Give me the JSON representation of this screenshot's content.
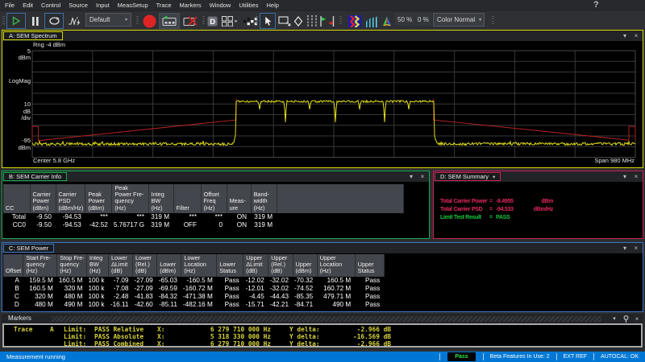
{
  "app": {
    "help_icon": "?"
  },
  "menu": {
    "items": [
      "File",
      "Edit",
      "Control",
      "Source",
      "Input",
      "MeasSetup",
      "Trace",
      "Markers",
      "Window",
      "Utilities",
      "Help"
    ]
  },
  "toolbar": {
    "icons": [
      "play-icon",
      "pause-icon",
      "restart-loop-icon",
      "single-sweep-icon",
      "record-icon",
      "recorder-player-icon",
      "recorder-close-icon",
      "display-d-icon",
      "window-layout-icon",
      "couplings-dots-icon",
      "select-cursor-icon",
      "zoom-box-icon",
      "marker-diamond-icon",
      "band-lines-icon",
      "limit-flags-icon",
      "spectrogram-icon",
      "waterfall-icon",
      "colormap-icon"
    ],
    "preset_combo": "Default",
    "percent_50": "50 %",
    "percent_0": "0 %",
    "color_combo": "Color Normal",
    "combo_caret": "▾"
  },
  "windows": {
    "spectrum": {
      "title": "A: SEM Spectrum",
      "minimize_icon": "▾",
      "close_icon": "×",
      "rng_label": "Rng -4 dBm",
      "y_top": "5",
      "y_top_unit": "dBm",
      "scale_label": "LogMag",
      "per_div_1": "10",
      "per_div_2": "dB",
      "per_div_3": "/div",
      "y_bottom": "-95",
      "y_bottom_unit": "dBm",
      "x_left": "Center 5.8 GHz",
      "x_right": "Span 980 MHz"
    },
    "carrier_info": {
      "title": "B: SEM Carrier Info",
      "headers": [
        "CC",
        "Carrier\nPower\n(dBm)",
        "Carrier\nPSD\n(dBm/Hz)",
        "Peak\nPower\n(dBm)",
        "Peak\nPower Fre-\nquency\n(Hz)",
        "Integ\nBW\n(Hz)",
        "Filter",
        "Offset\nFreq\n(Hz)",
        "Meas-\nure",
        "Band-\nwidth\n(Hz)",
        ""
      ],
      "rows": [
        [
          "Total",
          "-9.50",
          "-94.53",
          "***",
          "***",
          "319 M",
          "***",
          "***",
          "ON",
          "319 M",
          ""
        ],
        [
          "CC0",
          "-9.50",
          "-94.53",
          "-42.52",
          "5.76717 G",
          "319 M",
          "OFF",
          "0",
          "ON",
          "319 M",
          ""
        ]
      ]
    },
    "summary": {
      "title": "D: SEM Summary",
      "dropdown_icon": "▾",
      "lines": [
        {
          "label": "Total Carrier Power",
          "eq": "=",
          "value": "-9.4955",
          "unit": "dBm",
          "color": "red"
        },
        {
          "label": "Total Carrier PSD",
          "eq": "=",
          "value": "-94.533",
          "unit": "dBm/Hz",
          "color": "red"
        },
        {
          "label": "Limit Test Result",
          "eq": "=",
          "value": "PASS",
          "unit": "",
          "color": "green"
        }
      ]
    },
    "power": {
      "title": "C: SEM Power",
      "headers": [
        "Offset",
        "Start Fre-\nquency\n(Hz)",
        "Stop Fre-\nquency\n(Hz)",
        "Integ\nBW\n(Hz)",
        "Lower\nΔLimit\n(dB)",
        "Lower\n(Rel.)\n(dB)",
        "Lower\n(dBm)",
        "Lower\nLocation\n(Hz)",
        "Lower\nStatus",
        "Upper\nΔLimit\n(dB)",
        "Upper\n(Rel.)\n(dB)",
        "Upper\n(dBm)",
        "Upper\nLocation\n(Hz)",
        "Upper\nStatus"
      ],
      "rows": [
        [
          "A",
          "159.5 M",
          "160.5 M",
          "100 k",
          "-7.09",
          "-27.09",
          "-65.03",
          "-160.5 M",
          "Pass",
          "-12.02",
          "-32.02",
          "-70.32",
          "160.5 M",
          "Pass"
        ],
        [
          "B",
          "160.5 M",
          "320 M",
          "100 k",
          "-7.08",
          "-27.09",
          "-69.59",
          "-160.72 M",
          "Pass",
          "-12.01",
          "-32.02",
          "-74.52",
          "160.72 M",
          "Pass"
        ],
        [
          "C",
          "320 M",
          "480 M",
          "100 k",
          "-2.48",
          "-41.83",
          "-84.32",
          "-471.38 M",
          "Pass",
          "-4.45",
          "-44.43",
          "-85.35",
          "479.71 M",
          "Pass"
        ],
        [
          "D",
          "480 M",
          "490 M",
          "100 k",
          "-16.11",
          "-42.60",
          "-85.11",
          "-482.16 M",
          "Pass",
          "-15.71",
          "-42.21",
          "-84.71",
          "490 M",
          "Pass"
        ]
      ]
    },
    "markers": {
      "title": "Markers",
      "rows": [
        {
          "trace": "Trace",
          "trace_id": "A",
          "limit_label": "Limit:",
          "result": "PASS Relative",
          "x_label": "X:",
          "x_value": "6 279 710 000 Hz",
          "y_label": "Y delta:",
          "y_value": "-2.966 dB"
        },
        {
          "trace": "",
          "trace_id": "",
          "limit_label": "Limit:",
          "result": "PASS Absolute",
          "x_label": "X:",
          "x_value": "5 318 330 000 Hz",
          "y_label": "Y delta:",
          "y_value": "-16.569 dB"
        },
        {
          "trace": "",
          "trace_id": "",
          "limit_label": "Limit:",
          "result": "PASS Combined",
          "x_label": "X:",
          "x_value": "6 279 710 000 Hz",
          "y_label": "Y delta:",
          "y_value": "-2.966 dB"
        }
      ]
    }
  },
  "status_bar": {
    "left": "Measurement running",
    "pass_badge": "Pass",
    "segments": [
      "Beta Features In Use: 2",
      "EXT REF",
      "AUTOCAL: OK"
    ]
  },
  "chart_data": {
    "type": "line",
    "title": "A: SEM Spectrum",
    "x_axis": {
      "center": "5.8 GHz",
      "span": "980 MHz",
      "divisions": 10
    },
    "y_axis": {
      "top_dbm": 5,
      "bottom_dbm": -95,
      "db_per_div": 10,
      "scale": "LogMag",
      "range_dbm": -4
    },
    "series": [
      {
        "name": "spectrum-trace",
        "color": "#e3df18",
        "noise_floor_dbm": -82.5,
        "carrier": {
          "start_frac": 0.3382,
          "stop_frac": 0.6657,
          "top_dbm": -42.6
        },
        "notches": [
          {
            "frac": 0.377,
            "depth_dbm": -50,
            "w": 1
          },
          {
            "frac": 0.4198,
            "depth_dbm": -62,
            "w": 1
          },
          {
            "frac": 0.4599,
            "depth_dbm": -50,
            "w": 1
          },
          {
            "frac": 0.5033,
            "depth_dbm": -62,
            "w": 1
          },
          {
            "frac": 0.5428,
            "depth_dbm": -50,
            "w": 1
          },
          {
            "frac": 0.5842,
            "depth_dbm": -62,
            "w": 1
          },
          {
            "frac": 0.6243,
            "depth_dbm": -50,
            "w": 1
          }
        ]
      },
      {
        "name": "limit-mask",
        "color": "#b42222",
        "segments": [
          [
            [
              0,
              -80
            ],
            [
              0,
              -66
            ],
            [
              0.0102,
              -66
            ],
            [
              0.0102,
              -79.4
            ],
            [
              0.338,
              -60
            ],
            [
              0.338,
              -40
            ]
          ],
          [
            [
              0.6657,
              -40
            ],
            [
              0.6657,
              -60
            ],
            [
              0.9893,
              -78.9
            ],
            [
              0.9893,
              -66
            ],
            [
              1,
              -66
            ],
            [
              1,
              -80
            ]
          ]
        ]
      }
    ]
  },
  "colors": {
    "window_a_border": "#d8d800",
    "window_b_border": "#15a94c",
    "window_c_border": "#3a76c4",
    "window_d_border": "#cc2057",
    "markers_border": "#a9a9a9",
    "status_bar": "#0077d4",
    "pass_green": "#2ee54a",
    "summary_red": "#e2285e",
    "summary_green": "#17c93c",
    "trace_yellow": "#e3df18",
    "mask_red": "#b42222"
  }
}
